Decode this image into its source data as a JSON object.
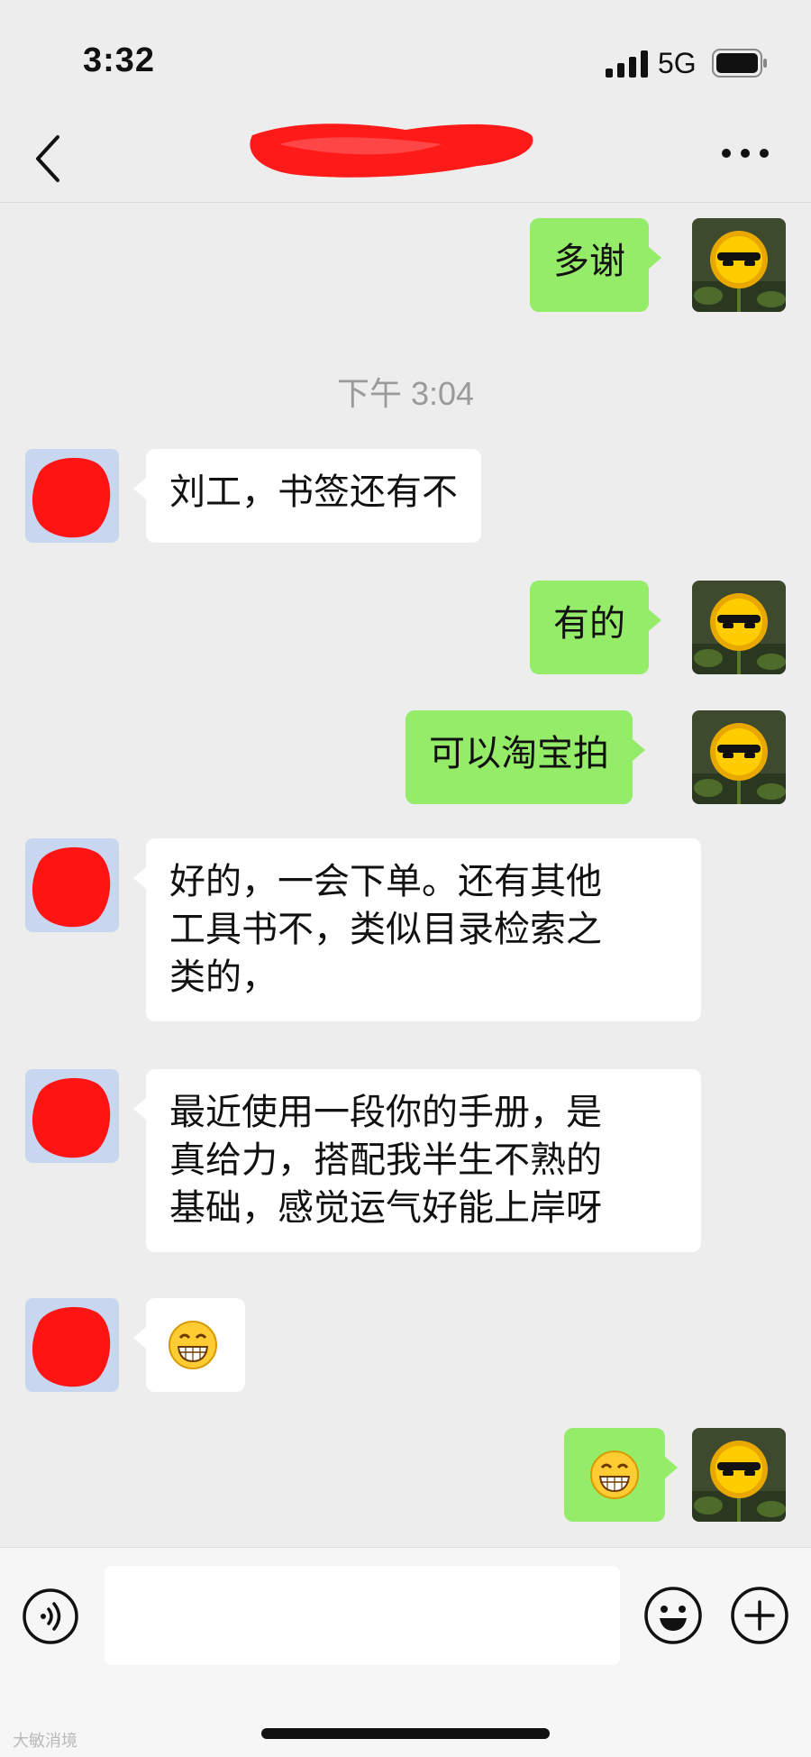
{
  "status_bar": {
    "time": "3:32",
    "network": "5G",
    "icons": [
      "signal-bars-icon",
      "battery-icon"
    ]
  },
  "nav": {
    "icons": [
      "back-chevron-icon",
      "more-dots-icon"
    ],
    "title_redacted": true
  },
  "chat": {
    "timestamp": "下午 3:04",
    "messages": [
      {
        "side": "right",
        "text": "多谢"
      },
      {
        "side": "left",
        "text": "刘工，书签还有不"
      },
      {
        "side": "right",
        "text": "有的"
      },
      {
        "side": "right",
        "text": "可以淘宝拍"
      },
      {
        "side": "left",
        "lines": [
          "好的，一会下单。还有其他",
          "工具书不，类似目录检索之",
          "类的，"
        ]
      },
      {
        "side": "left",
        "lines": [
          "最近使用一段你的手册，是",
          "真给力，搭配我半生不熟的",
          "基础，感觉运气好能上岸呀"
        ]
      },
      {
        "side": "left",
        "emoji": "grinning-face-icon"
      },
      {
        "side": "right",
        "emoji": "grinning-face-icon"
      }
    ]
  },
  "input_bar": {
    "placeholder": "",
    "icons": [
      "voice-icon",
      "emoji-icon",
      "plus-icon"
    ]
  },
  "watermark": "大敏消境",
  "colors": {
    "background": "#ededed",
    "self_bubble": "#95ec69",
    "other_bubble": "#ffffff",
    "redaction": "#ff1a1a"
  }
}
